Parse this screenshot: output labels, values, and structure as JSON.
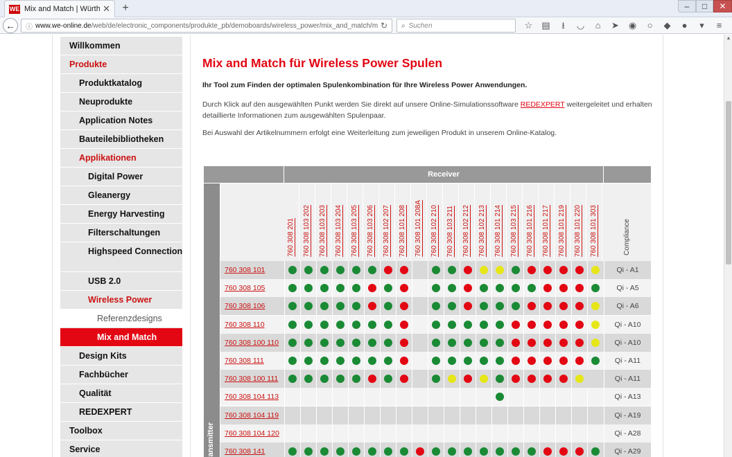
{
  "browser": {
    "tab_title": "Mix and Match | Würth Ele...",
    "favicon_text": "WE",
    "url_domain": "www.we-online.de",
    "url_path": "/web/de/electronic_components/produkte_pb/demoboards/wireless_power/mix_and_match/mixan",
    "search_placeholder": "Suchen"
  },
  "sidebar": {
    "items": [
      {
        "label": "Willkommen",
        "level": 0,
        "style": "normal"
      },
      {
        "label": "Produkte",
        "level": 0,
        "style": "red"
      },
      {
        "label": "Produktkatalog",
        "level": 1,
        "style": "normal"
      },
      {
        "label": "Neuprodukte",
        "level": 1,
        "style": "normal"
      },
      {
        "label": "Application Notes",
        "level": 1,
        "style": "normal"
      },
      {
        "label": "Bauteilebibliotheken",
        "level": 1,
        "style": "normal"
      },
      {
        "label": "Applikationen",
        "level": 1,
        "style": "red"
      },
      {
        "label": "Digital Power",
        "level": 2,
        "style": "normal"
      },
      {
        "label": "Gleanergy",
        "level": 2,
        "style": "normal"
      },
      {
        "label": "Energy Harvesting",
        "level": 2,
        "style": "normal"
      },
      {
        "label": "Filterschaltungen",
        "level": 2,
        "style": "normal"
      },
      {
        "label": "Highspeed Connection",
        "level": 2,
        "style": "twoline"
      },
      {
        "label": "USB 2.0",
        "level": 2,
        "style": "normal"
      },
      {
        "label": "Wireless Power",
        "level": 2,
        "style": "red"
      },
      {
        "label": "Referenzdesigns",
        "level": 3,
        "style": "sub"
      },
      {
        "label": "Mix and Match",
        "level": 3,
        "style": "active"
      },
      {
        "label": "Design Kits",
        "level": 1,
        "style": "normal"
      },
      {
        "label": "Fachbücher",
        "level": 1,
        "style": "normal"
      },
      {
        "label": "Qualität",
        "level": 1,
        "style": "normal"
      },
      {
        "label": "REDEXPERT",
        "level": 1,
        "style": "normal"
      },
      {
        "label": "Toolbox",
        "level": 0,
        "style": "normal"
      },
      {
        "label": "Service",
        "level": 0,
        "style": "normal"
      }
    ]
  },
  "main": {
    "title": "Mix and Match für Wireless Power Spulen",
    "intro": "Ihr Tool zum Finden der optimalen Spulenkombination für Ihre Wireless Power Anwendungen.",
    "para1_before": "Durch Klick auf den ausgewählten Punkt werden Sie direkt auf unsere Online-Simulationssoftware ",
    "para1_link": "REDEXPERT",
    "para1_after": " weitergeleitet und erhalten detaillierte Informationen zum ausgewählten Spulenpaar.",
    "para2": "Bei Auswahl der Artikelnummern erfolgt eine Weiterleitung zum jeweiligen Produkt in unserem Online-Katalog."
  },
  "matrix": {
    "receiver_header": "Receiver",
    "transmitter_label": "Transmitter",
    "compliance_header": "Compliance",
    "receivers": [
      "760 308 201",
      "760 308 103 202",
      "760 308 103 203",
      "760 308 103 204",
      "760 308 103 205",
      "760 308 103 206",
      "760 308 102 207",
      "760 308 101 208",
      "760 308 101 208A",
      "760 308 102 210",
      "760 308 103 211",
      "760 308 102 212",
      "760 308 102 213",
      "760 308 101 214",
      "760 308 103 215",
      "760 308 101 216",
      "760 308 101 217",
      "760 308 101 219",
      "760 308 101 220",
      "760 308 101 303"
    ],
    "status_colors": {
      "g": "#1a8a35",
      "r": "#e30613",
      "y": "#e6e619"
    },
    "rows": [
      {
        "tx": "760 308 101",
        "compliance": "Qi - A1",
        "cells": "ggggggrr_ggryygrrrry"
      },
      {
        "tx": "760 308 105",
        "compliance": "Qi - A5",
        "cells": "gggggrgr_ggrggggrrrg"
      },
      {
        "tx": "760 308 106",
        "compliance": "Qi - A6",
        "cells": "gggggrgr_ggrgggrrrry"
      },
      {
        "tx": "760 308 110",
        "compliance": "Qi - A10",
        "cells": "gggggggr_gggggrrrrry"
      },
      {
        "tx": "760 308 100 110",
        "compliance": "Qi - A10",
        "cells": "gggggggr_gggggrrrrry"
      },
      {
        "tx": "760 308 111",
        "compliance": "Qi - A11",
        "cells": "gggggggr_gggggrrrrrg"
      },
      {
        "tx": "760 308 100 111",
        "compliance": "Qi - A11",
        "cells": "gggggrgr_gyrygrrrry"
      },
      {
        "tx": "760 308 104 113",
        "compliance": "Qi - A13",
        "cells": "_____________g______"
      },
      {
        "tx": "760 308 104 119",
        "compliance": "Qi - A19",
        "cells": "____________________"
      },
      {
        "tx": "760 308 104 120",
        "compliance": "Qi - A28",
        "cells": "____________________"
      },
      {
        "tx": "760 308 141",
        "compliance": "Qi - A29",
        "cells": "ggggggggrgggggggrrrg"
      }
    ]
  }
}
